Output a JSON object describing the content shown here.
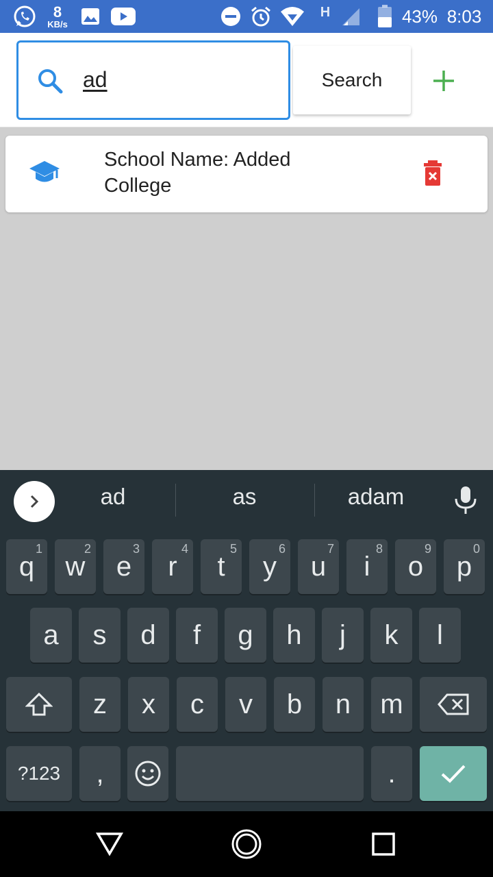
{
  "status_bar": {
    "speed_value": "8",
    "speed_unit": "KB/s",
    "network": "H",
    "battery": "43%",
    "time": "8:03"
  },
  "search": {
    "value": "ad",
    "button_label": "Search"
  },
  "results": [
    {
      "text": "School Name: Added College"
    }
  ],
  "keyboard": {
    "suggestions": [
      "ad",
      "as",
      "adam"
    ],
    "row1": [
      {
        "k": "q",
        "h": "1"
      },
      {
        "k": "w",
        "h": "2"
      },
      {
        "k": "e",
        "h": "3"
      },
      {
        "k": "r",
        "h": "4"
      },
      {
        "k": "t",
        "h": "5"
      },
      {
        "k": "y",
        "h": "6"
      },
      {
        "k": "u",
        "h": "7"
      },
      {
        "k": "i",
        "h": "8"
      },
      {
        "k": "o",
        "h": "9"
      },
      {
        "k": "p",
        "h": "0"
      }
    ],
    "row2": [
      "a",
      "s",
      "d",
      "f",
      "g",
      "h",
      "j",
      "k",
      "l"
    ],
    "row3": [
      "z",
      "x",
      "c",
      "v",
      "b",
      "n",
      "m"
    ],
    "symbols_label": "?123",
    "comma_label": ",",
    "period_label": "."
  },
  "colors": {
    "accent": "#2f8de4",
    "add": "#4caf50",
    "delete": "#e53935",
    "enter_key": "#6fb3a6"
  }
}
